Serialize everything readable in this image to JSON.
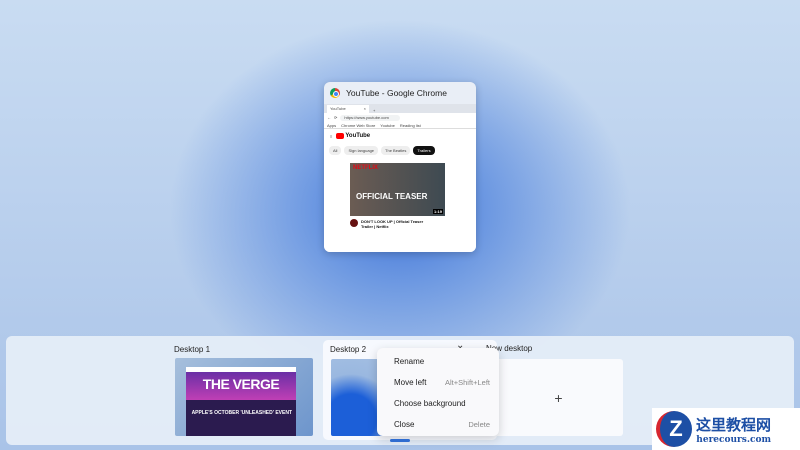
{
  "window": {
    "title": "YouTube - Google Chrome",
    "browser": {
      "tab": "YouTube",
      "url": "https://www.youtube.com",
      "bookmarks": [
        "Apps",
        "Chrome Web Store",
        "Youtube",
        "Reading list"
      ],
      "logo": "YouTube",
      "chips": [
        "All",
        "Sign language",
        "The Beatles",
        "Trailers"
      ],
      "video": {
        "brand": "NETFLIX",
        "overlay": "OFFICIAL TEASER",
        "duration": "1:19",
        "title": "DON'T LOOK UP | Official Teaser Trailer | Netflix"
      }
    }
  },
  "desktops": [
    {
      "label": "Desktop 1",
      "thumb_title": "THE VERGE",
      "thumb_text": "APPLE'S OCTOBER 'UNLEASHED' EVENT"
    },
    {
      "label": "Desktop 2"
    },
    {
      "label": "New desktop",
      "add_icon": "+"
    }
  ],
  "context_menu": [
    {
      "label": "Rename",
      "shortcut": ""
    },
    {
      "label": "Move left",
      "shortcut": "Alt+Shift+Left"
    },
    {
      "label": "Choose background",
      "shortcut": ""
    },
    {
      "label": "Close",
      "shortcut": "Delete"
    }
  ],
  "watermark": {
    "title": "这里教程网",
    "url": "herecours.com"
  }
}
